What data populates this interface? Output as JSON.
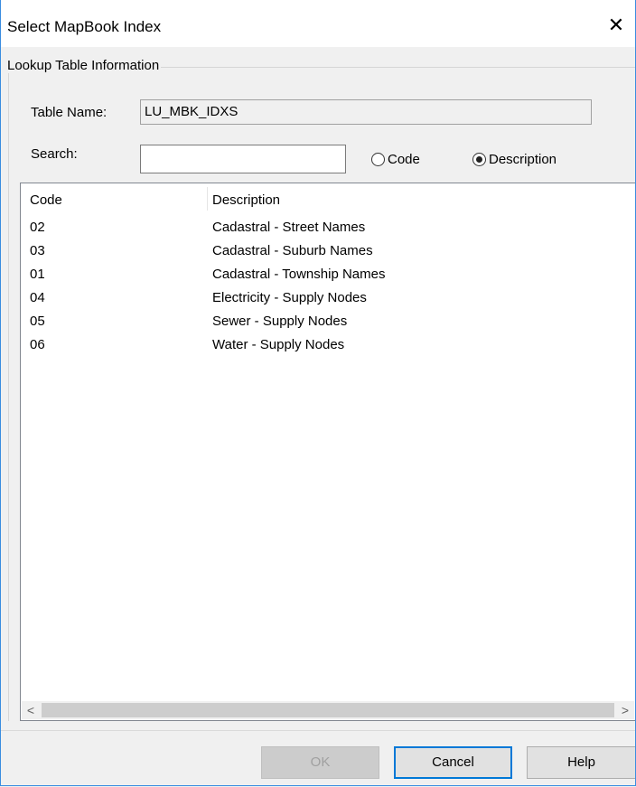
{
  "window": {
    "title": "Select MapBook Index",
    "close_glyph": "✕"
  },
  "group": {
    "label": "Lookup Table Information"
  },
  "table_name": {
    "label": "Table Name:",
    "value": "LU_MBK_IDXS"
  },
  "search": {
    "label": "Search:",
    "value": "",
    "placeholder": ""
  },
  "search_mode": {
    "options": [
      {
        "label": "Code",
        "selected": false
      },
      {
        "label": "Description",
        "selected": true
      }
    ]
  },
  "list": {
    "columns": [
      "Code",
      "Description"
    ],
    "rows": [
      {
        "code": "02",
        "description": "Cadastral - Street Names"
      },
      {
        "code": "03",
        "description": "Cadastral - Suburb Names"
      },
      {
        "code": "01",
        "description": "Cadastral - Township Names"
      },
      {
        "code": "04",
        "description": "Electricity - Supply Nodes"
      },
      {
        "code": "05",
        "description": "Sewer - Supply Nodes"
      },
      {
        "code": "06",
        "description": "Water - Supply Nodes"
      }
    ]
  },
  "scrollbar": {
    "left_glyph": "<",
    "right_glyph": ">"
  },
  "buttons": {
    "ok": "OK",
    "cancel": "Cancel",
    "help": "Help"
  },
  "colors": {
    "accent": "#0078d7",
    "window_border": "#3a8de0"
  }
}
